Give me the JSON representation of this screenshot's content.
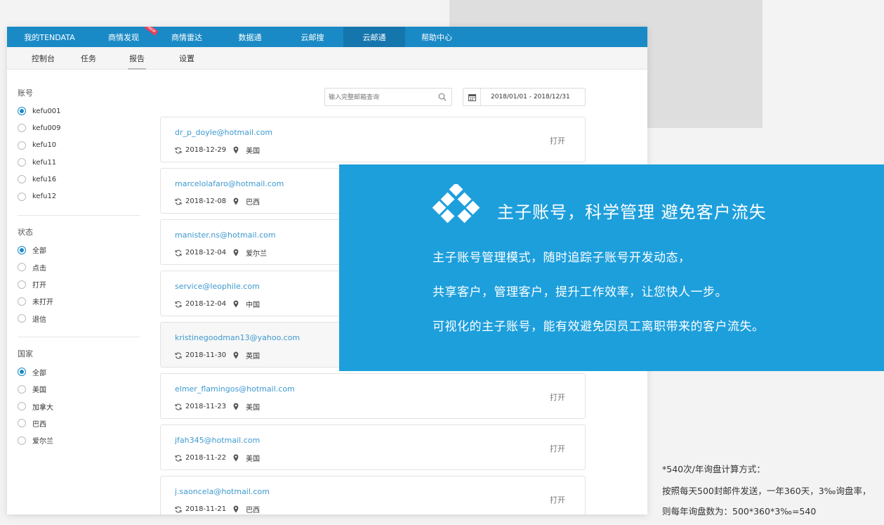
{
  "topnav": {
    "items": [
      "我的TENDATA",
      "商情发现",
      "商情雷达",
      "数据通",
      "云邮搜",
      "云邮通",
      "帮助中心"
    ],
    "new_badge": "New",
    "accent_color": "#1a8ac6"
  },
  "subnav": {
    "items": [
      "控制台",
      "任务",
      "报告",
      "设置"
    ]
  },
  "sidebar": {
    "account": {
      "title": "账号",
      "options": [
        "kefu001",
        "kefu009",
        "kefu10",
        "kefu11",
        "kefu16",
        "kefu12"
      ]
    },
    "status": {
      "title": "状态",
      "options": [
        "全部",
        "点击",
        "打开",
        "未打开",
        "退信"
      ]
    },
    "country": {
      "title": "国家",
      "options": [
        "全部",
        "美国",
        "加拿大",
        "巴西",
        "爱尔兰"
      ]
    }
  },
  "search": {
    "placeholder": "输入完整邮箱查询"
  },
  "date_range": "2018/01/01 - 2018/12/31",
  "emails": [
    {
      "address": "dr_p_doyle@hotmail.com",
      "date": "2018-12-29",
      "country": "美国",
      "status": "打开"
    },
    {
      "address": "marcelolafaro@hotmail.com",
      "date": "2018-12-08",
      "country": "巴西",
      "status": ""
    },
    {
      "address": "manister.ns@hotmail.com",
      "date": "2018-12-04",
      "country": "爱尔兰",
      "status": ""
    },
    {
      "address": "service@leophile.com",
      "date": "2018-12-04",
      "country": "中国",
      "status": ""
    },
    {
      "address": "kristinegoodman13@yahoo.com",
      "date": "2018-11-30",
      "country": "英国",
      "status": ""
    },
    {
      "address": "elmer_flamingos@hotmail.com",
      "date": "2018-11-23",
      "country": "美国",
      "status": "打开"
    },
    {
      "address": "jfah345@hotmail.com",
      "date": "2018-11-22",
      "country": "美国",
      "status": "打开"
    },
    {
      "address": "j.saoncela@hotmail.com",
      "date": "2018-11-21",
      "country": "巴西",
      "status": "打开"
    }
  ],
  "promo": {
    "headline": "主子账号，科学管理 避免客户流失",
    "lines": [
      "主子账号管理模式，随时追踪子账号开发动态，",
      "共享客户，管理客户，提升工作效率，让您快人一步。",
      "可视化的主子账号，能有效避免因员工离职带来的客户流失。"
    ],
    "bg_color": "#1d9fdc"
  },
  "footnote": {
    "lines": [
      "*540次/年询盘计算方式：",
      "按照每天500封邮件发送，一年360天，3‰询盘率，",
      "则每年询盘数为：500*360*3‰=540"
    ]
  }
}
